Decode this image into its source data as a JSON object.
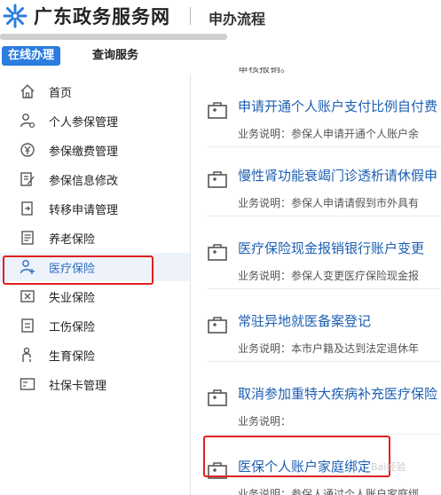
{
  "header": {
    "site_name": "广东政务服务网",
    "page_title": "申办流程",
    "logo_icon": "star-snowflake-logo",
    "brand_color": "#2b7de0"
  },
  "tabs": [
    {
      "label": "在线办理",
      "active": true
    },
    {
      "label": "查询服务",
      "active": false
    }
  ],
  "sidebar": {
    "items": [
      {
        "label": "首页",
        "icon": "home-icon"
      },
      {
        "label": "个人参保管理",
        "icon": "person-gear-icon"
      },
      {
        "label": "参保缴费管理",
        "icon": "payment-icon"
      },
      {
        "label": "参保信息修改",
        "icon": "edit-document-icon"
      },
      {
        "label": "转移申请管理",
        "icon": "transfer-icon"
      },
      {
        "label": "养老保险",
        "icon": "pension-document-icon"
      },
      {
        "label": "医疗保险",
        "icon": "medical-person-icon",
        "active": true
      },
      {
        "label": "失业保险",
        "icon": "unemployment-icon"
      },
      {
        "label": "工伤保险",
        "icon": "injury-document-icon"
      },
      {
        "label": "生育保险",
        "icon": "maternity-icon"
      },
      {
        "label": "社保卡管理",
        "icon": "social-card-icon"
      }
    ]
  },
  "content": {
    "clipped_top_text": "审核报销。",
    "services": [
      {
        "title": "申请开通个人账户支付比例自付费",
        "desc": "业务说明：参保人申请开通个人账户余"
      },
      {
        "title": "慢性肾功能衰竭门诊透析请休假申",
        "desc": "业务说明：参保人申请请假到市外具有"
      },
      {
        "title": "医疗保险现金报销银行账户变更",
        "desc": "业务说明：参保人变更医疗保险现金报"
      },
      {
        "title": "常驻异地就医备案登记",
        "desc": "业务说明：本市户籍及达到法定退休年"
      },
      {
        "title": "取消参加重特大疾病补充医疗保险",
        "desc": "业务说明："
      },
      {
        "title": "医保个人账户家庭绑定",
        "desc": "业务说明：参保人通过个人账户家庭绑"
      }
    ],
    "watermark": "Bai经验"
  }
}
